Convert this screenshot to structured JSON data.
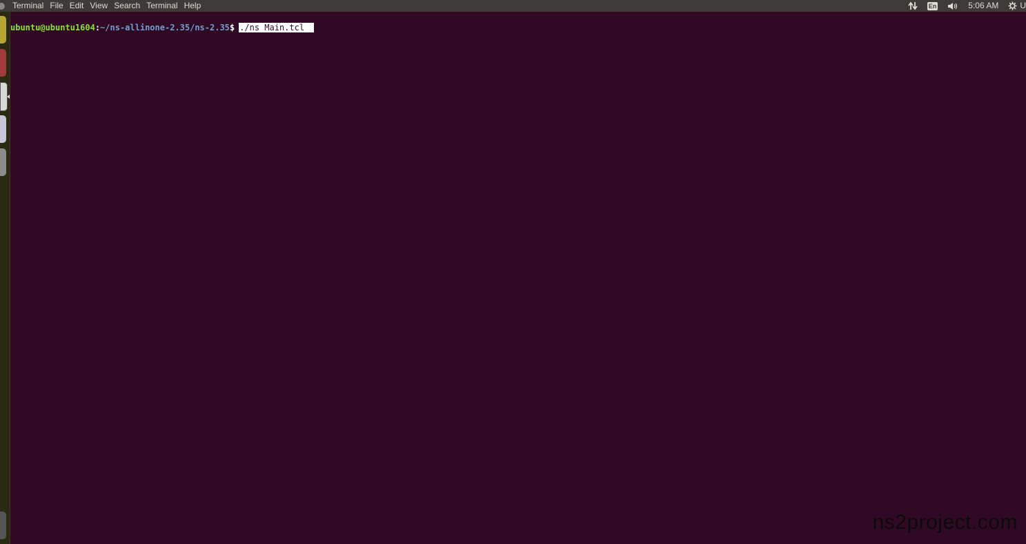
{
  "topbar": {
    "menu": [
      "Terminal",
      "File",
      "Edit",
      "View",
      "Search",
      "Terminal",
      "Help"
    ],
    "keyboard_layout": "En",
    "clock": "5:06 AM",
    "user_initial": "U",
    "icons": [
      "network-arrows-icon",
      "volume-icon",
      "gear-icon"
    ]
  },
  "terminal": {
    "user_host": "ubuntu@ubuntu1604",
    "colon": ":",
    "path": "~/ns-allinone-2.35/ns-2.35",
    "dollar": "$",
    "command": "./ns Main.tcl"
  },
  "watermark": "ns2project.com",
  "colors": {
    "terminal_bg": "#300a24",
    "topbar_bg": "#3c3b37",
    "user_green": "#8ae234",
    "path_blue": "#729fcf"
  }
}
